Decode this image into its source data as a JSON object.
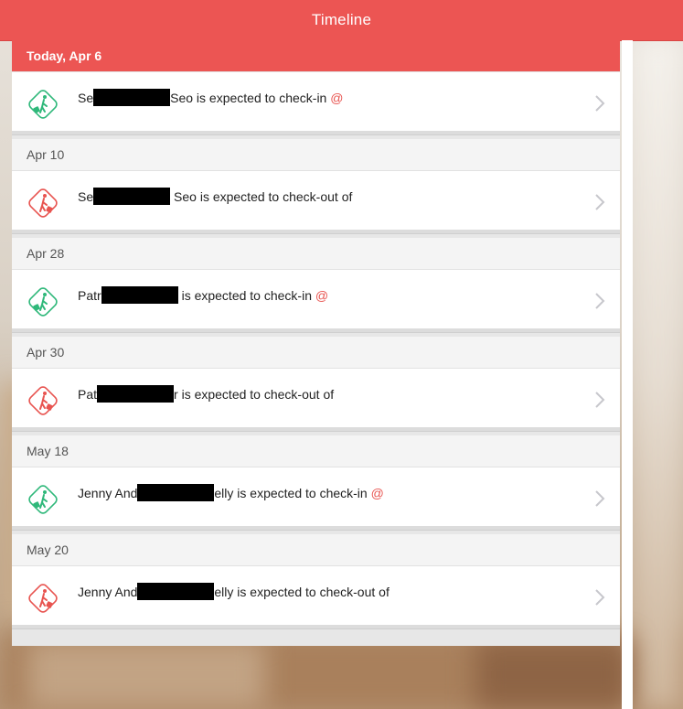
{
  "header": {
    "title": "Timeline"
  },
  "colors": {
    "accent": "#ec5553",
    "checkin": "#2fb87a",
    "checkout": "#e85450"
  },
  "groups": [
    {
      "date": "Today, Apr 6",
      "today": true,
      "entry": {
        "type": "check-in",
        "icon": "walking-person-luggage-icon",
        "name_start": "Se",
        "name_end": "Seo",
        "text": " is expected to check-in ",
        "at": "@"
      }
    },
    {
      "date": "Apr 10",
      "today": false,
      "entry": {
        "type": "check-out",
        "icon": "walking-person-luggage-icon",
        "name_start": "Se",
        "name_end": " Seo",
        "text": " is expected to check-out of",
        "at": ""
      }
    },
    {
      "date": "Apr 28",
      "today": false,
      "entry": {
        "type": "check-in",
        "icon": "walking-person-luggage-icon",
        "name_start": "Patr",
        "name_end": "",
        "text": " is expected to check-in ",
        "at": "@"
      }
    },
    {
      "date": "Apr 30",
      "today": false,
      "entry": {
        "type": "check-out",
        "icon": "walking-person-luggage-icon",
        "name_start": "Pat",
        "name_end": "r",
        "text": " is expected to check-out of",
        "at": ""
      }
    },
    {
      "date": "May 18",
      "today": false,
      "entry": {
        "type": "check-in",
        "icon": "walking-person-luggage-icon",
        "name_start": "Jenny And",
        "name_end": "elly",
        "text": " is expected to check-in ",
        "at": "@"
      }
    },
    {
      "date": "May 20",
      "today": false,
      "entry": {
        "type": "check-out",
        "icon": "walking-person-luggage-icon",
        "name_start": "Jenny And",
        "name_end": "elly",
        "text": " is expected to check-out of",
        "at": ""
      }
    }
  ]
}
